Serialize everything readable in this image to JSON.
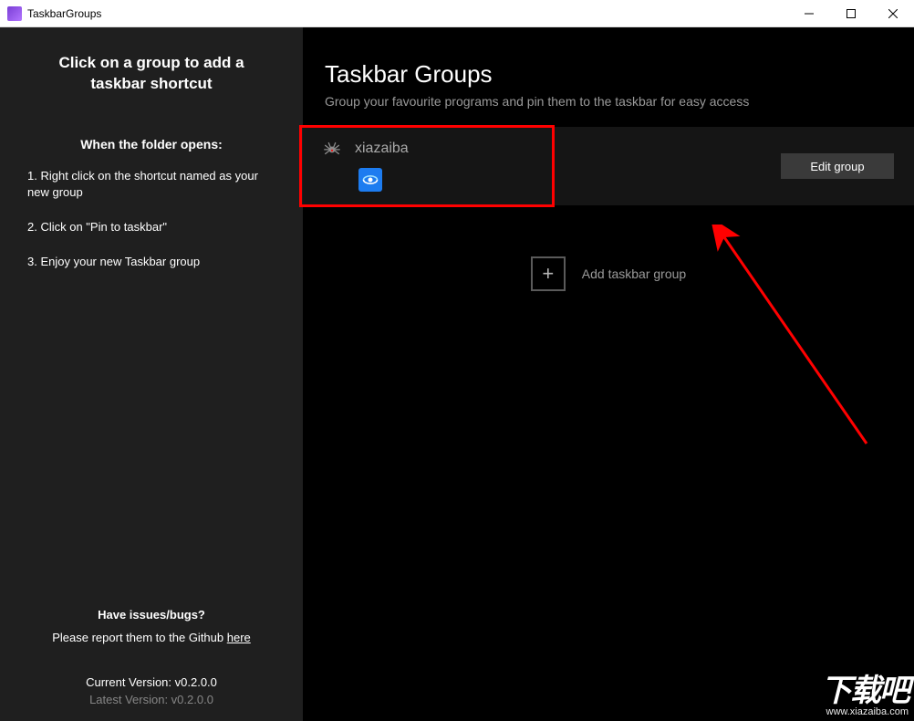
{
  "window": {
    "title": "TaskbarGroups"
  },
  "sidebar": {
    "heading_line1": "Click on a group to add a",
    "heading_line2": "taskbar shortcut",
    "subheader": "When the folder opens:",
    "steps": [
      "1. Right click on the shortcut named as your new group",
      "2. Click on \"Pin to taskbar\"",
      "3. Enjoy your new Taskbar group"
    ],
    "issues_heading": "Have issues/bugs?",
    "issues_text_pre": "Please report them to the Github ",
    "issues_link": "here",
    "current_version_label": "Current Version:  v0.2.0.0",
    "latest_version_label": "Latest Version:  v0.2.0.0"
  },
  "main": {
    "title": "Taskbar Groups",
    "subtitle": "Group your favourite programs and pin them to the taskbar for easy access",
    "group": {
      "name": "xiazaiba",
      "icon": "spider-icon",
      "items": [
        {
          "icon": "item-360-icon"
        }
      ]
    },
    "edit_button": "Edit group",
    "add_label": "Add taskbar group"
  },
  "watermark": {
    "logo_text": "下载吧",
    "url": "www.xiazaiba.com"
  }
}
